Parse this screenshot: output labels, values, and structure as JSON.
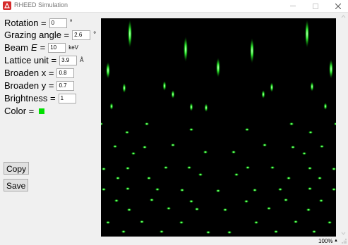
{
  "window": {
    "title": "RHEED Simulation",
    "minimize_icon": "minimize-icon",
    "maximize_icon": "maximize-icon",
    "close_icon": "close-icon"
  },
  "controls": {
    "rotation": {
      "label": "Rotation =",
      "value": "0",
      "unit": "°"
    },
    "grazing_angle": {
      "label": "Grazing angle =",
      "value": "2.6",
      "unit": "°"
    },
    "beam_energy": {
      "label_prefix": "Beam",
      "label_symbol": "E",
      "label_suffix": "=",
      "value": "10",
      "unit": "keV"
    },
    "lattice_unit": {
      "label": "Lattice unit =",
      "value": "3.9",
      "unit": "Å"
    },
    "broaden_x": {
      "label": "Broaden x =",
      "value": "0.8"
    },
    "broaden_y": {
      "label": "Broaden y =",
      "value": "0.7"
    },
    "brightness": {
      "label": "Brightness =",
      "value": "1"
    },
    "color": {
      "label": "Color =",
      "value": "#00e000"
    }
  },
  "buttons": {
    "copy": "Copy",
    "save": "Save"
  },
  "status": {
    "zoom": "100%"
  },
  "colors": {
    "spot": "#3cff3c",
    "background": "#000000",
    "ui": "#f0f0f0"
  }
}
